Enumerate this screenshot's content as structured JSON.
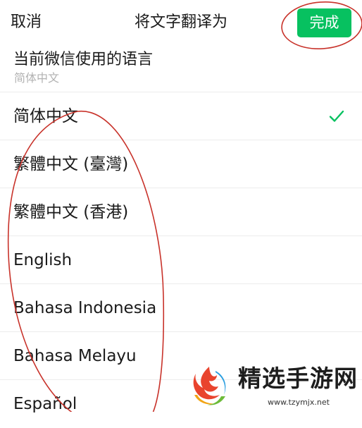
{
  "header": {
    "cancel_label": "取消",
    "title": "将文字翻译为",
    "done_label": "完成"
  },
  "current_language": {
    "title": "当前微信使用的语言",
    "value": "简体中文"
  },
  "languages": [
    {
      "label": "简体中文",
      "selected": true
    },
    {
      "label": "繁體中文 (臺灣)",
      "selected": false
    },
    {
      "label": "繁體中文 (香港)",
      "selected": false
    },
    {
      "label": "English",
      "selected": false
    },
    {
      "label": "Bahasa Indonesia",
      "selected": false
    },
    {
      "label": "Bahasa Melayu",
      "selected": false
    },
    {
      "label": "Español",
      "selected": false
    }
  ],
  "check_icon": "checkmark-icon",
  "watermark": {
    "name": "精选手游网",
    "url": "www.tzymjx.net"
  },
  "colors": {
    "accent": "#07c160",
    "annotation": "#c8322a",
    "secondary_text": "#b2b2b2"
  }
}
